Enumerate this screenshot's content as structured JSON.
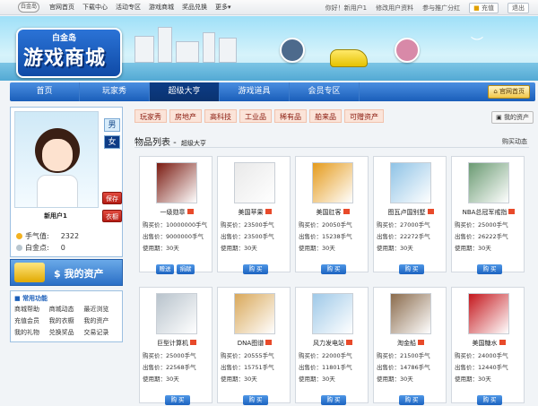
{
  "topbar": {
    "logo": "白金岛",
    "nav": [
      "官网首页",
      "下载中心",
      "活动专区",
      "游戏商城",
      "奖品兑换",
      "更多▾"
    ],
    "greeting": "你好！新用户1",
    "edit_profile": "修改用户资料",
    "promote": "参与推广分红",
    "recharge": "充值",
    "logout": "退出"
  },
  "banner": {
    "brand_small": "白金岛",
    "brand_big": "游戏商城"
  },
  "mainnav": {
    "items": [
      "首页",
      "玩家秀",
      "超级大亨",
      "游戏道具",
      "会员专区"
    ],
    "active": 2,
    "home_button": "官网首页"
  },
  "profile": {
    "sex_male": "男",
    "sex_female": "女",
    "save": "保存",
    "wardrobe": "衣橱",
    "username": "新用户1",
    "handgas_label": "手气值:",
    "handgas_value": "2322",
    "whitegold_label": "白金点:",
    "whitegold_value": "0"
  },
  "assets_button": "我的资产",
  "functions": {
    "title": "常用功能",
    "items": [
      "商城帮助",
      "商城动态",
      "最近浏览",
      "充值会员",
      "我的衣橱",
      "我的资产",
      "我的礼物",
      "兑换奖品",
      "交易记录"
    ]
  },
  "categories": [
    "玩家秀",
    "房地产",
    "高科技",
    "工业品",
    "稀有品",
    "舶来品",
    "可赠资产"
  ],
  "my_assets_button": "我的资产",
  "list": {
    "title": "物品列表 -",
    "subtitle": "超级大亨",
    "dynamics": "购买动态"
  },
  "labels": {
    "buy_price": "购买价：",
    "sell_price": "出售价：",
    "period": "使用期："
  },
  "products": [
    {
      "name": "一级勋章",
      "buy": "10000000手气",
      "sell": "9000000手气",
      "period": "30天",
      "buttons": [
        "赠送",
        "捐献"
      ],
      "thumb_color": "#7a1a10"
    },
    {
      "name": "美国苹果",
      "buy": "23500手气",
      "sell": "23500手气",
      "period": "30天",
      "buttons": [
        "购 买"
      ],
      "thumb_color": "#e9e9e9"
    },
    {
      "name": "美国肛客",
      "buy": "20050手气",
      "sell": "15238手气",
      "period": "30天",
      "buttons": [
        "购 买"
      ],
      "thumb_color": "#e59b1c"
    },
    {
      "name": "图瓦卢国别墅",
      "buy": "27000手气",
      "sell": "22272手气",
      "period": "30天",
      "buttons": [
        "购 买"
      ],
      "thumb_color": "#8fc3e6"
    },
    {
      "name": "NBA总冠军戒指",
      "buy": "25000手气",
      "sell": "26222手气",
      "period": "30天",
      "buttons": [
        "购 买"
      ],
      "thumb_color": "#6a9a72"
    },
    {
      "name": "巨型计算机",
      "buy": "25000手气",
      "sell": "22568手气",
      "period": "30天",
      "buttons": [
        "购 买"
      ],
      "thumb_color": "#b8c3cc"
    },
    {
      "name": "DNA图谱",
      "buy": "20555手气",
      "sell": "15751手气",
      "period": "30天",
      "buttons": [
        "购 买"
      ],
      "thumb_color": "#d9a85a"
    },
    {
      "name": "风力发电站",
      "buy": "22000手气",
      "sell": "11801手气",
      "period": "30天",
      "buttons": [
        "购 买"
      ],
      "thumb_color": "#9fc9e8"
    },
    {
      "name": "淘金船",
      "buy": "21500手气",
      "sell": "14786手气",
      "period": "30天",
      "buttons": [
        "购 买"
      ],
      "thumb_color": "#8a6b4c"
    },
    {
      "name": "美国糖水",
      "buy": "24000手气",
      "sell": "12440手气",
      "period": "30天",
      "buttons": [
        "购 买"
      ],
      "thumb_color": "#c4161c"
    }
  ]
}
